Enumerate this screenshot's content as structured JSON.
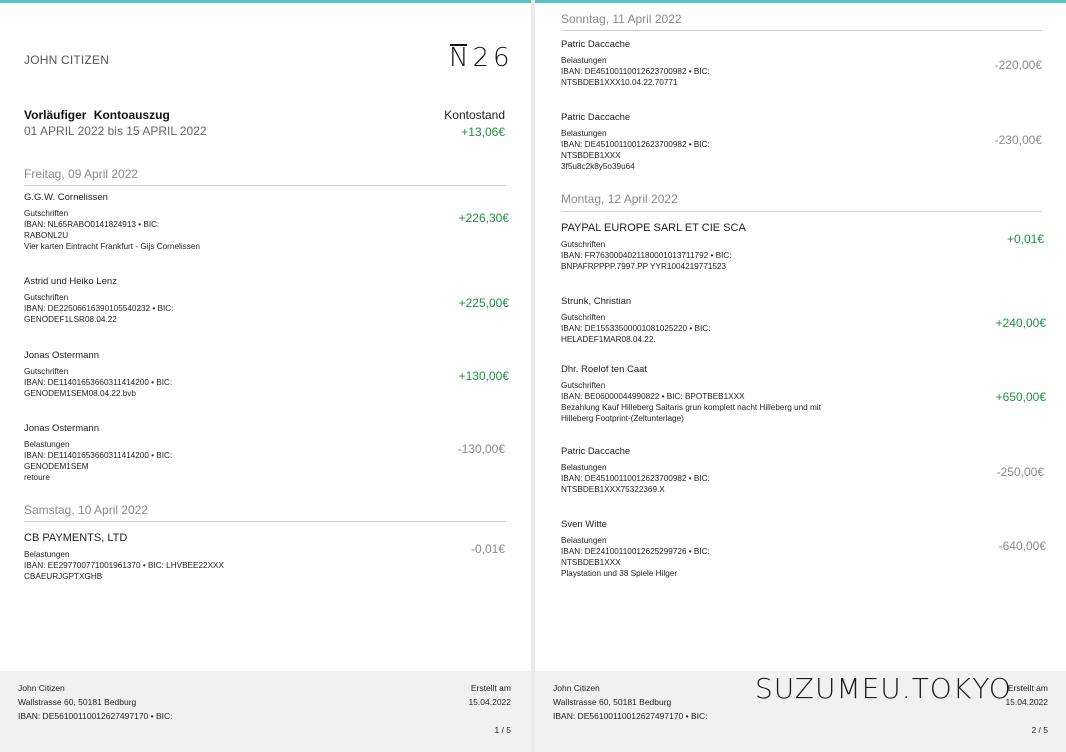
{
  "account_holder": "JOHN CITIZEN",
  "logo": {
    "n": "N",
    "rest": "26"
  },
  "statement": {
    "title": "Vorläufiger Kontoauszug",
    "range": "01 APRIL 2022 bis 15 APRIL 2022",
    "balance_label": "Kontostand",
    "balance_value": "+13,06€"
  },
  "page1": {
    "days": [
      {
        "label": "Freitag, 09 April 2022"
      },
      {
        "label": "Samstag, 10 April 2022"
      }
    ],
    "transactions": [
      {
        "name": "G.G.W. Cornelissen",
        "type": "Gutschriften",
        "lines": [
          "IBAN: NL65RABO0141824913 • BIC:",
          "RABONL2U",
          "Vier karten Eintracht Frankfurt - Gijs Cornelissen"
        ],
        "amount": "+226,30€"
      },
      {
        "name": "Astrid und Heiko Lenz",
        "type": "Gutschriften",
        "lines": [
          "IBAN: DE22506616390105540232 • BIC:",
          "GENODEF1LSR08.04.22"
        ],
        "amount": "+225,00€"
      },
      {
        "name": "Jonas Ostermann",
        "type": "Gutschriften",
        "lines": [
          "IBAN: DE11401653660311414200 • BIC:",
          "GENODEM1SEM08.04.22.bvb"
        ],
        "amount": "+130,00€"
      },
      {
        "name": "Jonas Ostermann",
        "type": "Belastungen",
        "lines": [
          "IBAN: DE11401653660311414200 • BIC:",
          "GENODEM1SEM",
          "retoure"
        ],
        "amount": "-130,00€"
      },
      {
        "name": "CB PAYMENTS, LTD",
        "type": "Belastungen",
        "lines": [
          "IBAN: EE297700771001961370 • BIC: LHVBEE22XXX",
          "CBAEURJGPTXGHB"
        ],
        "amount": "-0,01€"
      }
    ]
  },
  "page2": {
    "days": [
      {
        "label": "Sonntag, 11 April 2022"
      },
      {
        "label": "Montag, 12 April 2022"
      }
    ],
    "transactions": [
      {
        "name": "Patric Daccache",
        "type": "Belastungen",
        "lines": [
          "IBAN: DE45100110012623700982 • BIC:",
          "NTSBDEB1XXX10.04.22.70771"
        ],
        "amount": "-220,00€"
      },
      {
        "name": "Patric Daccache",
        "type": "Belastungen",
        "lines": [
          "IBAN: DE45100110012623700982 • BIC:",
          "NTSBDEB1XXX",
          "3f5u8c2k8y5o39u64"
        ],
        "amount": "-230,00€"
      },
      {
        "name": "PAYPAL EUROPE SARL ET CIE SCA",
        "type": "Gutschriften",
        "lines": [
          "IBAN: FR7630004021180001013711792 • BIC:",
          "BNPAFRPPPP.7997.PP YYR1004219771523"
        ],
        "amount": "+0,01€"
      },
      {
        "name": "Strunk, Christian",
        "type": "Gutschriften",
        "lines": [
          "IBAN: DE15533500001081025220 • BIC:",
          "HELADEF1MAR08.04.22."
        ],
        "amount": "+240,00€"
      },
      {
        "name": "Dhr. Roelof ten Caat",
        "type": "Gutschriften",
        "lines": [
          "IBAN: BE06000044990822 • BIC: BPOTBEB1XXX",
          "Bezahlung Kauf Hilleberg Saitaris grun komplett nacht Hilleberg und mit",
          "Hilleberg Footprint-(Zeltunterlage)"
        ],
        "amount": "+650,00€"
      },
      {
        "name": "Patric Daccache",
        "type": "Belastungen",
        "lines": [
          "IBAN: DE45100110012623700982 • BIC:",
          "NTSBDEB1XXX75322369.X"
        ],
        "amount": "-250,00€"
      },
      {
        "name": "Sven Witte",
        "type": "Belastungen",
        "lines": [
          "IBAN: DE24100110012625299726 • BIC:",
          "NTSBDEB1XXX",
          "Playstation und 38 Spiele Hilger"
        ],
        "amount": "-640,00€"
      }
    ]
  },
  "footer": {
    "name": "John Citizen",
    "address": "Wallstrasse 60, 50181 Bedburg",
    "iban": "IBAN: DE56100110012627497170 • BIC:",
    "created_label": "Erstellt am",
    "created_date": "15.04.2022",
    "page1_num": "1 / 5",
    "page2_num": "2 / 5"
  },
  "watermark": "SUZUMEU.TOKYO"
}
